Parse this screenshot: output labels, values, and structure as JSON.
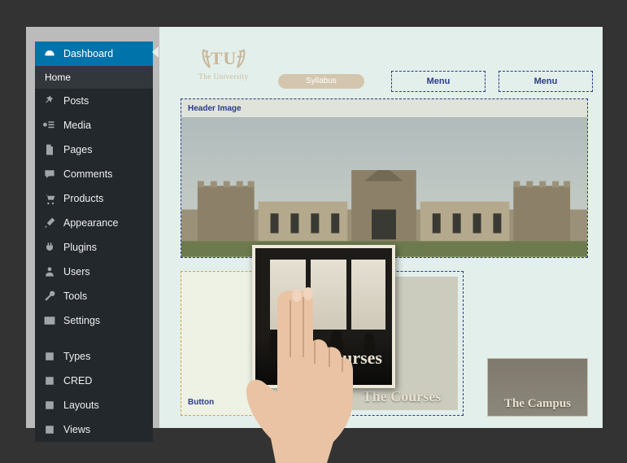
{
  "sidebar": {
    "items": [
      {
        "label": "Dashboard",
        "icon": "dashboard-icon",
        "active": true
      },
      {
        "label": "Home",
        "sub": true
      },
      {
        "label": "Posts",
        "icon": "pin-icon"
      },
      {
        "label": "Media",
        "icon": "media-icon"
      },
      {
        "label": "Pages",
        "icon": "page-icon"
      },
      {
        "label": "Comments",
        "icon": "comment-icon"
      },
      {
        "label": "Products",
        "icon": "cart-icon"
      },
      {
        "label": "Appearance",
        "icon": "brush-icon"
      },
      {
        "label": "Plugins",
        "icon": "plug-icon"
      },
      {
        "label": "Users",
        "icon": "user-icon"
      },
      {
        "label": "Tools",
        "icon": "wrench-icon"
      },
      {
        "label": "Settings",
        "icon": "sliders-icon"
      },
      {
        "gap": true
      },
      {
        "label": "Types",
        "icon": "calendar-icon"
      },
      {
        "label": "CRED",
        "icon": "calendar-icon"
      },
      {
        "label": "Layouts",
        "icon": "calendar-icon"
      },
      {
        "label": "Views",
        "icon": "calendar-icon"
      }
    ]
  },
  "header": {
    "logo_big": "TU",
    "logo_small": "The University",
    "syllabus_label": "Syllabus",
    "menu1": "Menu",
    "menu2": "Menu"
  },
  "hero": {
    "label": "Header Image"
  },
  "columns": {
    "button_label": "Button",
    "courses_label": "The Courses",
    "campus_label": "The Campus",
    "drag_label": "urses"
  },
  "colors": {
    "accent": "#0073aa",
    "dash": "#2a3a8a",
    "beige": "#c9b79a"
  }
}
